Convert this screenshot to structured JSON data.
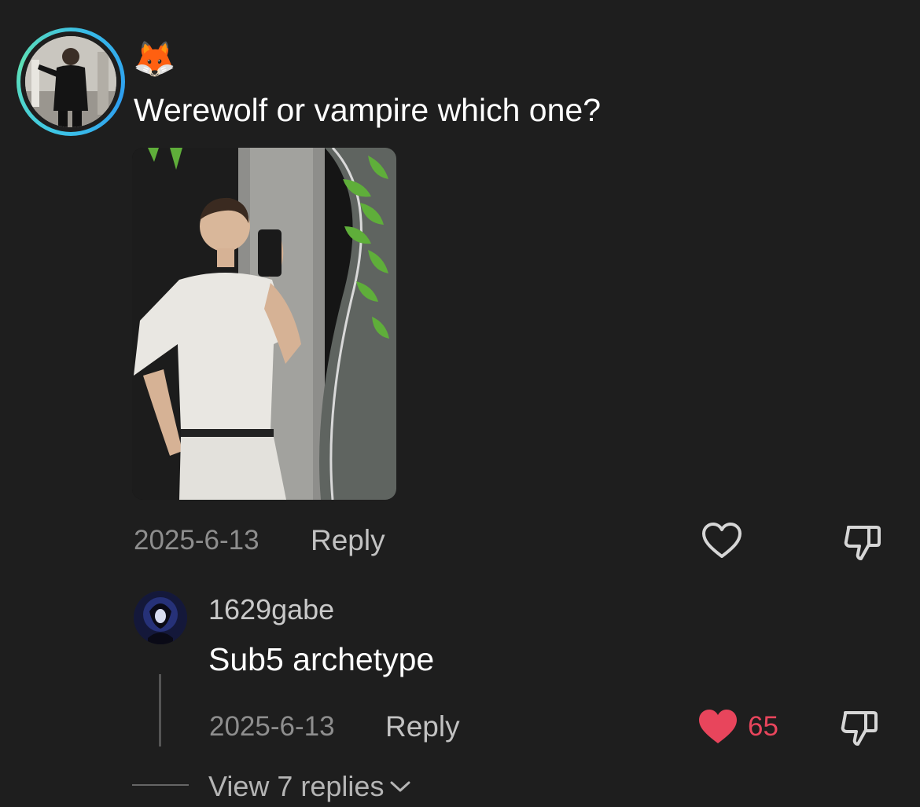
{
  "comment": {
    "username": "🦊",
    "text": "Werewolf or vampire which one?",
    "date": "2025-6-13",
    "reply_label": "Reply"
  },
  "reply": {
    "username": "1629gabe",
    "text": "Sub5 archetype",
    "date": "2025-6-13",
    "reply_label": "Reply",
    "likes": "65",
    "liked": true
  },
  "view_replies_label": "View 7 replies",
  "colors": {
    "background": "#1e1e1e",
    "like_red": "#e8455c",
    "story_ring": "#3ec7e6"
  }
}
